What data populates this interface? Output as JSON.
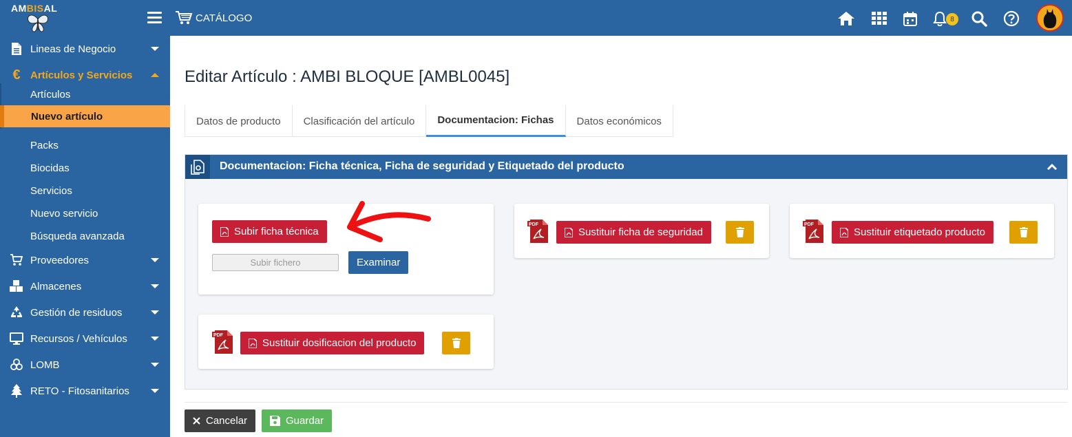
{
  "brand": {
    "logo_text_a": "AM",
    "logo_text_b": "BIS",
    "logo_text_c": "AL"
  },
  "topbar": {
    "catalog_label": "CATÁLOGO",
    "notifications_count": "8",
    "icons": [
      "home-icon",
      "apps-grid-icon",
      "calendar-icon",
      "bell-icon",
      "search-icon",
      "help-icon"
    ]
  },
  "sidebar": {
    "groups": [
      {
        "label": "Lineas de Negocio",
        "icon": "document-icon"
      },
      {
        "label": "Artículos y Servicios",
        "icon": "euro-icon",
        "expanded": true
      },
      {
        "label": "Proveedores",
        "icon": "cart-icon"
      },
      {
        "label": "Almacenes",
        "icon": "boxes-icon"
      },
      {
        "label": "Gestión de residuos",
        "icon": "recycle-icon"
      },
      {
        "label": "Recursos / Vehículos",
        "icon": "monitor-icon"
      },
      {
        "label": "LOMB",
        "icon": "biohazard-icon"
      },
      {
        "label": "RETO - Fitosanitarios",
        "icon": "tree-icon"
      }
    ],
    "sub_items": [
      "Artículos",
      "Nuevo artículo",
      "Packs",
      "Biocidas",
      "Servicios",
      "Nuevo servicio",
      "Búsqueda avanzada"
    ]
  },
  "page": {
    "title": "Editar Artículo : AMBI BLOQUE [AMBL0045]",
    "tabs": [
      "Datos de producto",
      "Clasificación del artículo",
      "Documentacion: Fichas",
      "Datos económicos"
    ],
    "active_tab": "Documentacion: Fichas"
  },
  "panel": {
    "title": "Documentacion: Ficha técnica, Ficha de seguridad y Etiquetado del producto",
    "upload_card": {
      "button_label": "Subir ficha técnica",
      "file_placeholder": "Subir fichero",
      "browse_label": "Examinar"
    },
    "safety_card": {
      "button_label": "Sustituir ficha de seguridad"
    },
    "label_card": {
      "button_label": "Sustituir etiquetado producto"
    },
    "dosage_card": {
      "button_label": "Sustituir dosificacion del producto"
    },
    "pdf_badge": "PDF"
  },
  "footer": {
    "cancel_label": "Cancelar",
    "save_label": "Guardar"
  },
  "colors": {
    "primary": "#2a65a1",
    "accent_orange": "#f8a447",
    "danger": "#c71f35",
    "warning": "#e0a100",
    "success": "#5cb85c"
  }
}
